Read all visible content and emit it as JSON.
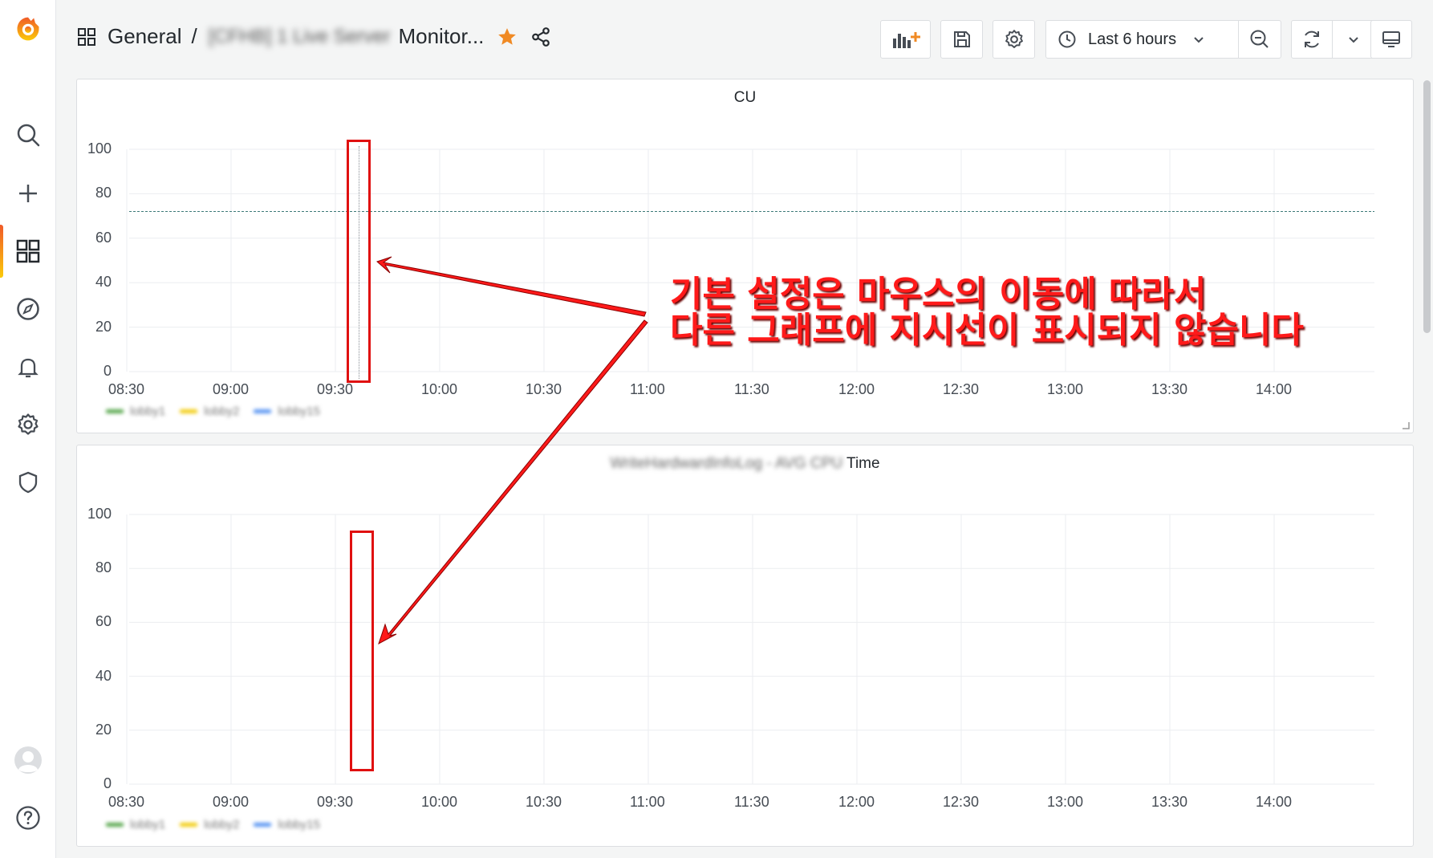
{
  "breadcrumb": {
    "folder": "General",
    "separator": "/",
    "title_obscured": "[CFHB] 1 Live Server",
    "title_visible": "Monitor..."
  },
  "toolbar": {
    "time_range": "Last 6 hours"
  },
  "panels": [
    {
      "title": "CU",
      "title_obscured": "",
      "y_ticks": [
        "100",
        "80",
        "60",
        "40",
        "20",
        "0"
      ],
      "x_ticks": [
        "08:30",
        "09:00",
        "09:30",
        "10:00",
        "10:30",
        "11:00",
        "11:30",
        "12:00",
        "12:30",
        "13:00",
        "13:30",
        "14:00"
      ],
      "legend": [
        {
          "name": "lobby1",
          "color": "#56a64b"
        },
        {
          "name": "lobby2",
          "color": "#f2cc0c"
        },
        {
          "name": "lobby15",
          "color": "#5794f2"
        }
      ]
    },
    {
      "title": "Time",
      "title_obscured": "WriteHardwardInfoLog - AVG CPU",
      "y_ticks": [
        "100",
        "80",
        "60",
        "40",
        "20",
        "0"
      ],
      "x_ticks": [
        "08:30",
        "09:00",
        "09:30",
        "10:00",
        "10:30",
        "11:00",
        "11:30",
        "12:00",
        "12:30",
        "13:00",
        "13:30",
        "14:00"
      ],
      "legend": [
        {
          "name": "lobby1",
          "color": "#56a64b"
        },
        {
          "name": "lobby2",
          "color": "#f2cc0c"
        },
        {
          "name": "lobby15",
          "color": "#5794f2"
        }
      ]
    }
  ],
  "annotation": {
    "line1": "기본 설정은 마우스의 이동에 따라서",
    "line2": "다른 그래프에 지시선이 표시되지 않습니다"
  },
  "colors": {
    "accent": "#f05a28",
    "annotation_red": "#ff1a1a",
    "threshold_line": "#3d7a78"
  }
}
